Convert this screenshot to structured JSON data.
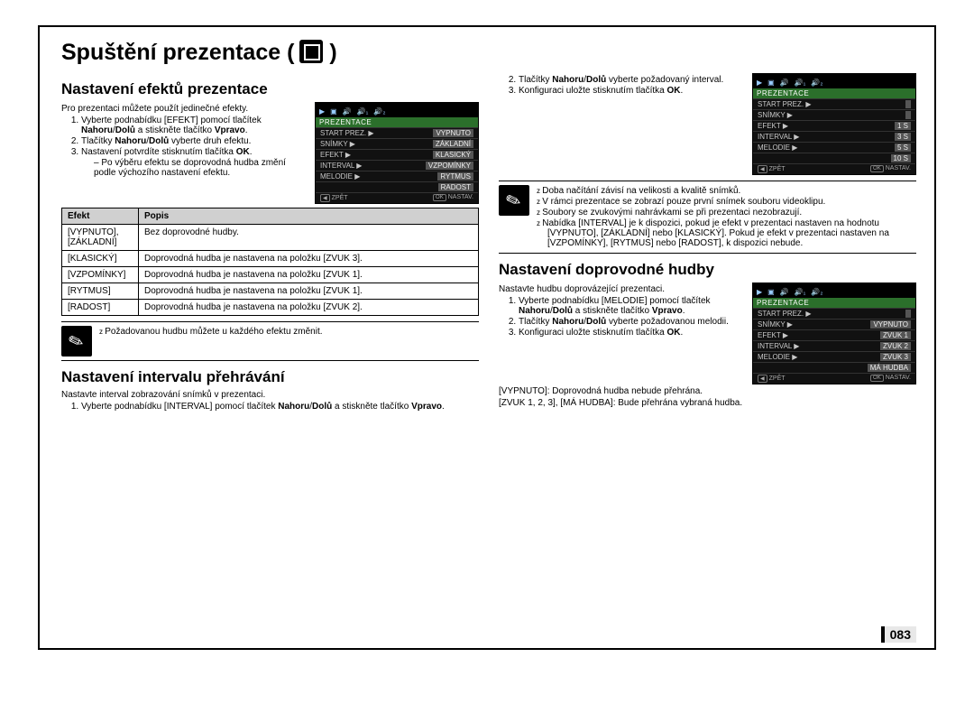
{
  "title": "Spuštění prezentace (",
  "title_suffix": " )",
  "pagenum": "083",
  "left": {
    "sec1_h": "Nastavení efektů prezentace",
    "sec1_intro": "Pro prezentaci můžete použít jedinečné efekty.",
    "sec1_steps": [
      "Vyberte podnabídku [EFEKT] pomocí tlačítek <b>Nahoru</b>/<b>Dolů</b> a stiskněte tlačítko <b>Vpravo</b>.",
      "Tlačítky <b>Nahoru</b>/<b>Dolů</b> vyberte druh efektu.",
      "Nastavení potvrdíte stisknutím tlačítka <b>OK</b>."
    ],
    "sec1_substep": "Po výběru efektu se doprovodná hudba změní podle výchozího nastavení efektu.",
    "table_h1": "Efekt",
    "table_h2": "Popis",
    "table_rows": [
      [
        "[VYPNUTO], [ZÁKLADNÍ]",
        "Bez doprovodné hudby."
      ],
      [
        "[KLASICKÝ]",
        "Doprovodná hudba je nastavena na položku [ZVUK 3]."
      ],
      [
        "[VZPOMÍNKY]",
        "Doprovodná hudba je nastavena na položku [ZVUK 1]."
      ],
      [
        "[RYTMUS]",
        "Doprovodná hudba je nastavena na položku [ZVUK 1]."
      ],
      [
        "[RADOST]",
        "Doprovodná hudba je nastavena na položku [ZVUK 2]."
      ]
    ],
    "note1": "Požadovanou hudbu můžete u každého efektu změnit.",
    "sec2_h": "Nastavení intervalu přehrávání",
    "sec2_intro": "Nastavte interval zobrazování snímků v prezentaci.",
    "sec2_step1": "Vyberte podnabídku [INTERVAL] pomocí tlačítek <b>Nahoru</b>/<b>Dolů</b> a stiskněte tlačítko <b>Vpravo</b>."
  },
  "right": {
    "cont_steps": [
      "Tlačítky <b>Nahoru</b>/<b>Dolů</b> vyberte požadovaný interval.",
      "Konfiguraci uložte stisknutím tlačítka <b>OK</b>."
    ],
    "notes": [
      "Doba načítání závisí na velikosti a kvalitě snímků.",
      "V rámci prezentace se zobrazí pouze první snímek souboru videoklipu.",
      "Soubory se zvukovými nahrávkami se při prezentaci nezobrazují.",
      "Nabídka [INTERVAL] je k dispozici, pokud je efekt v prezentaci nastaven na hodnotu [VYPNUTO], [ZÁKLADNÍ] nebo [KLASICKÝ]. Pokud je efekt v prezentaci nastaven na [VZPOMÍNKY], [RYTMUS] nebo [RADOST], k dispozici nebude."
    ],
    "sec3_h": "Nastavení doprovodné hudby",
    "sec3_intro": "Nastavte hudbu doprovázející prezentaci.",
    "sec3_steps": [
      "Vyberte podnabídku [MELODIE] pomocí tlačítek <b>Nahoru</b>/<b>Dolů</b> a stiskněte tlačítko <b>Vpravo</b>.",
      "Tlačítky <b>Nahoru</b>/<b>Dolů</b> vyberte požadovanou melodii.",
      "Konfiguraci uložte stisknutím tlačítka <b>OK</b>."
    ],
    "sec3_tail": [
      "[VYPNUTO]: Doprovodná hudba nebude přehrána.",
      "[ZVUK 1, 2, 3], [MÁ HUDBA]: Bude přehrána vybraná hudba."
    ]
  },
  "lcd": {
    "title": "PREZENTACE",
    "back": "ZPĚT",
    "set": "NASTAV.",
    "topicons": [
      "▶",
      "▣",
      "🔊",
      "🔊₁",
      "🔊₂"
    ],
    "screen1": [
      [
        "START PREZ.",
        "▶",
        "VYPNUTO"
      ],
      [
        "SNÍMKY",
        "▶",
        "ZÁKLADNÍ"
      ],
      [
        "EFEKT",
        "▶",
        "KLASICKÝ"
      ],
      [
        "INTERVAL",
        "▶",
        "VZPOMÍNKY"
      ],
      [
        "MELODIE",
        "▶",
        "RYTMUS"
      ],
      [
        "",
        "",
        "RADOST"
      ]
    ],
    "screen2": [
      [
        "START PREZ.",
        "▶",
        ""
      ],
      [
        "SNÍMKY",
        "▶",
        ""
      ],
      [
        "EFEKT",
        "▶",
        "1 S"
      ],
      [
        "INTERVAL",
        "▶",
        "3 S"
      ],
      [
        "MELODIE",
        "▶",
        "5 S"
      ],
      [
        "",
        "",
        "10 S"
      ]
    ],
    "screen3": [
      [
        "START PREZ.",
        "▶",
        ""
      ],
      [
        "SNÍMKY",
        "▶",
        "VYPNUTO"
      ],
      [
        "EFEKT",
        "▶",
        "ZVUK 1"
      ],
      [
        "INTERVAL",
        "▶",
        "ZVUK 2"
      ],
      [
        "MELODIE",
        "▶",
        "ZVUK 3"
      ],
      [
        "",
        "",
        "MÁ HUDBA"
      ]
    ]
  }
}
